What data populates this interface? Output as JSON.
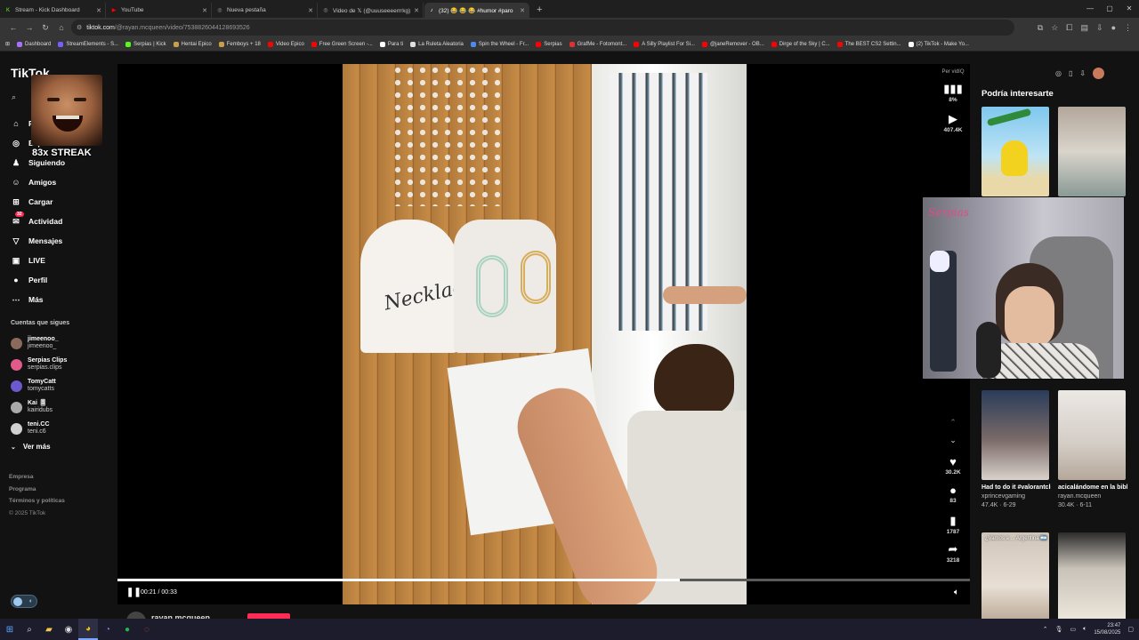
{
  "browser": {
    "tabs": [
      {
        "title": "Stream - Kick Dashboard",
        "fav": "K",
        "color": "#53fc18"
      },
      {
        "title": "YouTube",
        "fav": "▶",
        "color": "#ff0000"
      },
      {
        "title": "Nueva pestaña",
        "fav": "◎",
        "color": "#9aa0a6"
      },
      {
        "title": "Video de 𝕏 (@uuuseeeerrrkg)",
        "fav": "◎",
        "color": "#9aa0a6"
      },
      {
        "title": "(32) 😂 😂 😂 #humor #paro",
        "fav": "♪",
        "color": "#ffffff",
        "active": true
      }
    ],
    "new_tab": "+",
    "url_host": "tiktok.com",
    "url_path": "/@rayan.mcqueen/video/7538826044128693526",
    "bookmarks": [
      {
        "label": "Dashboard",
        "color": "#a970ff"
      },
      {
        "label": "StreamElements - S...",
        "color": "#7b5cff"
      },
      {
        "label": "Serpias | Kick",
        "color": "#53fc18"
      },
      {
        "label": "Hentai Epico",
        "color": "#c8a04a"
      },
      {
        "label": "Femboys + 18",
        "color": "#c8a04a"
      },
      {
        "label": "Video Epico",
        "color": "#ff0000"
      },
      {
        "label": "Free Green Screen -...",
        "color": "#ff0000"
      },
      {
        "label": "Para ti",
        "color": "#ffffff"
      },
      {
        "label": "La Ruleta Aleatoria",
        "color": "#e0e0e0"
      },
      {
        "label": "Spin the Wheel - Fr...",
        "color": "#4a8af4"
      },
      {
        "label": "Serpias",
        "color": "#ff0000"
      },
      {
        "label": "GrafMe - Fotomont...",
        "color": "#e03030"
      },
      {
        "label": "A Silly Playlist For Si...",
        "color": "#ff0000"
      },
      {
        "label": "@janeRemover - OB...",
        "color": "#ff0000"
      },
      {
        "label": "Dirge of the Sky | C...",
        "color": "#ff0000"
      },
      {
        "label": "The BEST CS2 Settin...",
        "color": "#ff0000"
      },
      {
        "label": "(2) TikTok - Make Yo...",
        "color": "#ffffff"
      }
    ]
  },
  "sidebar": {
    "logo": "TikTok",
    "streak_text": "83x STREAK",
    "nav": [
      {
        "icon": "⌂",
        "label": "Para ti"
      },
      {
        "icon": "◎",
        "label": "Explorar"
      },
      {
        "icon": "♟",
        "label": "Siguiendo"
      },
      {
        "icon": "☺",
        "label": "Amigos"
      },
      {
        "icon": "⊞",
        "label": "Cargar"
      },
      {
        "icon": "✉",
        "label": "Actividad",
        "badge": "32"
      },
      {
        "icon": "▽",
        "label": "Mensajes"
      },
      {
        "icon": "▣",
        "label": "LIVE"
      },
      {
        "icon": "●",
        "label": "Perfil"
      },
      {
        "icon": "⋯",
        "label": "Más"
      }
    ],
    "following_title": "Cuentas que sigues",
    "following": [
      {
        "name": "jimeenoo_",
        "handle": "jimeenoo_",
        "color": "#8a6a5a"
      },
      {
        "name": "Serpias Clips",
        "handle": "serpias.clips",
        "color": "#e05a8a"
      },
      {
        "name": "TomyCatt",
        "handle": "tomycatts",
        "color": "#6a5acd"
      },
      {
        "name": "Kai 🎚",
        "handle": "kairidubs",
        "color": "#aaaaaa"
      },
      {
        "name": "teni.CC",
        "handle": "teni.c6",
        "color": "#d0d0d0"
      }
    ],
    "see_more": "Ver más",
    "footer": [
      "Empresa",
      "Programa",
      "Términos y políticas"
    ],
    "copyright": "© 2025 TikTok"
  },
  "player": {
    "time_current": "00:21",
    "time_total": "00:33",
    "progress": 0.66,
    "per_label": "Per vidIQ",
    "stat_pct": "8%",
    "views": "407.4K",
    "likes": "30.2K",
    "comments": "83",
    "saves": "1787",
    "shares": "3218",
    "author": "rayan.mcqueen"
  },
  "recommend": {
    "title": "Podría interesarte",
    "items": [
      {
        "caption": "Had to do it #valorantclips...",
        "author": "xprincevgaming",
        "stats": "47.4K · 6-29"
      },
      {
        "caption": "acicalándome en la biblioteca #humor...",
        "author": "rayan.mcqueen",
        "stats": "30.4K · 6-11"
      }
    ],
    "thumb5_text": "¿Vamos a ... Argentina 🇦🇷"
  },
  "webcam": {
    "logo": "Serpias"
  },
  "taskbar": {
    "time": "23:47",
    "date": "15/08/2025"
  }
}
